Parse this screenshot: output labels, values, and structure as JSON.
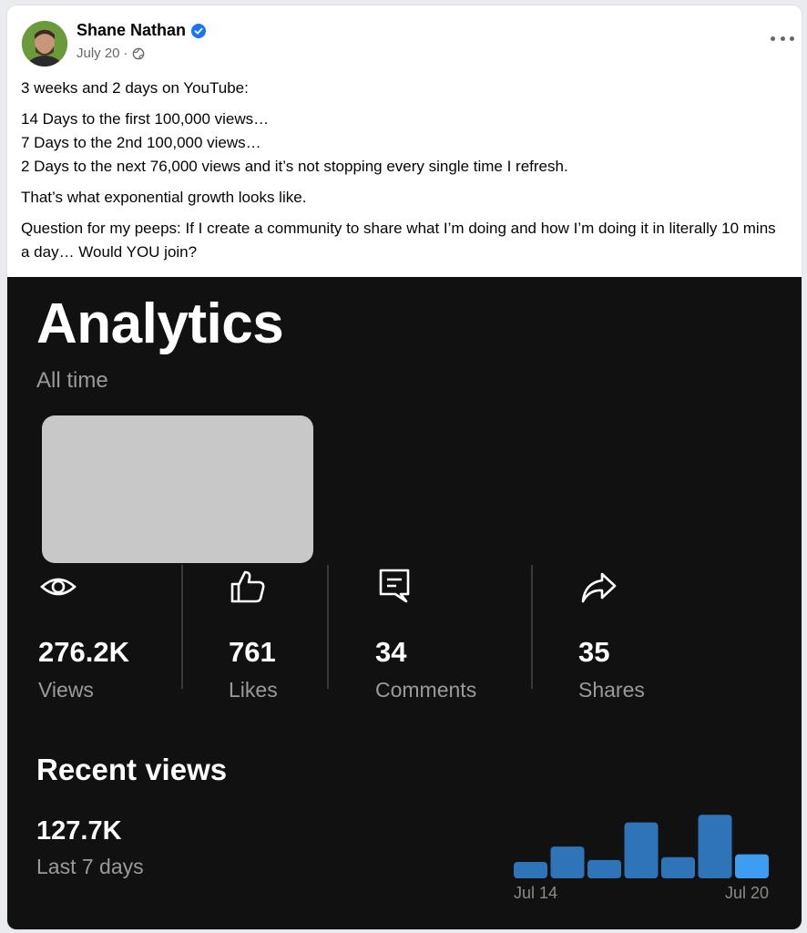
{
  "post": {
    "author": "Shane Nathan",
    "date": "July 20",
    "separator": "·",
    "lines": [
      "3 weeks and 2 days on YouTube:",
      "14 Days to the first 100,000 views…\n7 Days to the 2nd 100,000 views…\n2 Days to the next 76,000 views and it’s not stopping every single time I refresh.",
      "That’s what exponential growth looks like.",
      "Question for my peeps: If I create a community to share what I’m doing and how I’m doing it in literally 10 mins a day… Would YOU join?"
    ]
  },
  "analytics": {
    "title": "Analytics",
    "subtitle": "All time",
    "stats": [
      {
        "icon": "eye-icon",
        "value": "276.2K",
        "label": "Views"
      },
      {
        "icon": "thumbs-up-icon",
        "value": "761",
        "label": "Likes"
      },
      {
        "icon": "comment-icon",
        "value": "34",
        "label": "Comments"
      },
      {
        "icon": "share-icon",
        "value": "35",
        "label": "Shares"
      }
    ],
    "recent": {
      "title": "Recent views",
      "value": "127.7K",
      "label": "Last 7 days"
    }
  },
  "colors": {
    "bar": "#2f74b9",
    "bar_highlight": "#3d9df1",
    "verified": "#1877f2"
  },
  "chart_data": {
    "type": "bar",
    "categories": [
      "Jul 14",
      "Jul 15",
      "Jul 16",
      "Jul 17",
      "Jul 18",
      "Jul 19",
      "Jul 20"
    ],
    "tick_labels": [
      "Jul 14",
      "Jul 20"
    ],
    "values": [
      17,
      33,
      19,
      58,
      22,
      66,
      25
    ],
    "highlight_index": 6,
    "ylim": [
      0,
      70
    ],
    "grid": false
  }
}
